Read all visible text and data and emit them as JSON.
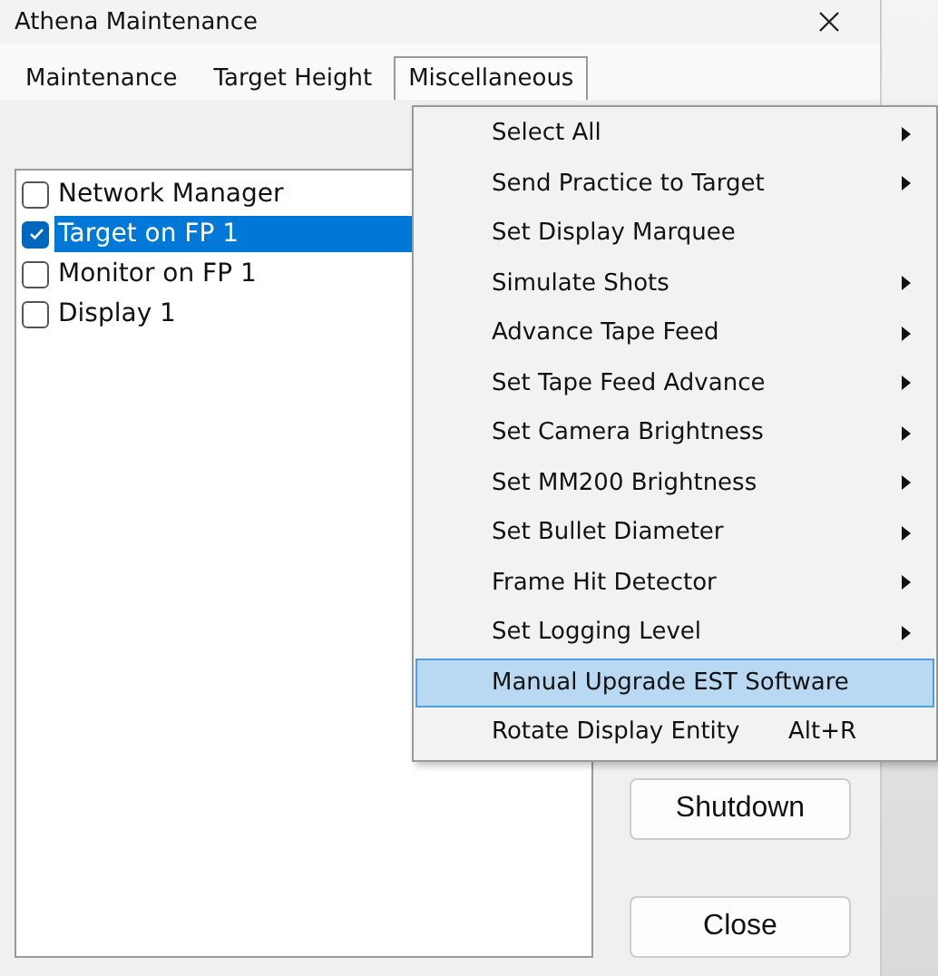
{
  "window": {
    "title": "Athena Maintenance"
  },
  "menubar": [
    {
      "label": "Maintenance",
      "selected": false
    },
    {
      "label": "Target Height",
      "selected": false
    },
    {
      "label": "Miscellaneous",
      "selected": true
    }
  ],
  "list": [
    {
      "label": "Network Manager",
      "checked": false,
      "selected": false
    },
    {
      "label": "Target on FP 1",
      "checked": true,
      "selected": true
    },
    {
      "label": "Monitor on FP 1",
      "checked": false,
      "selected": false
    },
    {
      "label": "Display 1",
      "checked": false,
      "selected": false
    }
  ],
  "buttons": [
    "Shutdown",
    "Close"
  ],
  "menu": [
    {
      "label": "Select All",
      "submenu": true,
      "selected": false
    },
    {
      "label": "Send Practice to Target",
      "submenu": true,
      "selected": false
    },
    {
      "label": "Set Display Marquee",
      "submenu": false,
      "selected": false
    },
    {
      "label": "Simulate Shots",
      "submenu": true,
      "selected": false
    },
    {
      "label": "Advance Tape Feed",
      "submenu": true,
      "selected": false
    },
    {
      "label": "Set Tape Feed Advance",
      "submenu": true,
      "selected": false
    },
    {
      "label": "Set Camera Brightness",
      "submenu": true,
      "selected": false
    },
    {
      "label": "Set MM200 Brightness",
      "submenu": true,
      "selected": false
    },
    {
      "label": "Set Bullet Diameter",
      "submenu": true,
      "selected": false
    },
    {
      "label": "Frame Hit Detector",
      "submenu": true,
      "selected": false
    },
    {
      "label": "Set Logging Level",
      "submenu": true,
      "selected": false
    },
    {
      "label": "Manual Upgrade EST Software",
      "submenu": false,
      "selected": true
    },
    {
      "label": "Rotate Display Entity",
      "submenu": false,
      "selected": false,
      "shortcut": "Alt+R"
    }
  ]
}
